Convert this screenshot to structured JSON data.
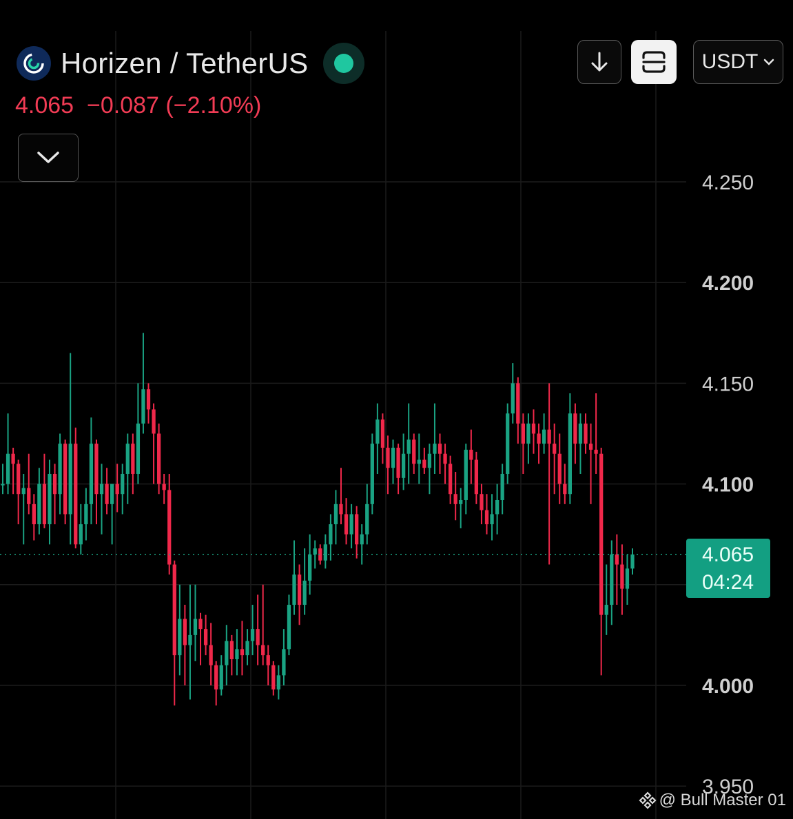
{
  "header": {
    "pair": "Horizen / TetherUS",
    "logo_icon": "horizen-logo-icon",
    "live_color": "#1fc7a0"
  },
  "price": {
    "last": "4.065",
    "change": "−0.087",
    "change_pct": "(−2.10%)",
    "color": "#f23c55"
  },
  "toolbar": {
    "quote_currency": "USDT",
    "download_icon": "arrow-down-icon",
    "fullscreen_icon": "frame-icon",
    "dropdown_icon": "chevron-down-icon",
    "collapse_icon": "chevron-down-icon"
  },
  "price_tag": {
    "value": "4.065",
    "countdown": "04:24"
  },
  "watermark": "@ Bull Master 01",
  "chart_data": {
    "type": "candlestick",
    "y_ticks": [
      "4.250",
      "4.200",
      "4.150",
      "4.100",
      "4.000",
      "3.950"
    ],
    "y_tick_values": [
      4.25,
      4.2,
      4.15,
      4.1,
      4.0,
      3.95
    ],
    "ylim": [
      3.945,
      4.32
    ],
    "grid": true,
    "up_color": "#1aa383",
    "down_color": "#f0284a",
    "current_price": 4.065,
    "candles": [
      [
        4.1,
        4.11,
        4.095,
        4.1
      ],
      [
        4.1,
        4.135,
        4.095,
        4.115
      ],
      [
        4.115,
        4.118,
        4.095,
        4.11
      ],
      [
        4.11,
        4.112,
        4.08,
        4.095
      ],
      [
        4.095,
        4.105,
        4.07,
        4.098
      ],
      [
        4.098,
        4.115,
        4.085,
        4.09
      ],
      [
        4.09,
        4.095,
        4.072,
        4.08
      ],
      [
        4.08,
        4.108,
        4.075,
        4.1
      ],
      [
        4.1,
        4.115,
        4.078,
        4.08
      ],
      [
        4.08,
        4.112,
        4.07,
        4.105
      ],
      [
        4.105,
        4.11,
        4.08,
        4.095
      ],
      [
        4.095,
        4.125,
        4.085,
        4.12
      ],
      [
        4.12,
        4.122,
        4.08,
        4.085
      ],
      [
        4.085,
        4.165,
        4.07,
        4.12
      ],
      [
        4.12,
        4.128,
        4.068,
        4.07
      ],
      [
        4.07,
        4.09,
        4.065,
        4.08
      ],
      [
        4.08,
        4.098,
        4.072,
        4.09
      ],
      [
        4.09,
        4.133,
        4.08,
        4.12
      ],
      [
        4.12,
        4.122,
        4.08,
        4.095
      ],
      [
        4.095,
        4.11,
        4.075,
        4.1
      ],
      [
        4.1,
        4.108,
        4.085,
        4.09
      ],
      [
        4.09,
        4.098,
        4.07,
        4.1
      ],
      [
        4.1,
        4.11,
        4.086,
        4.095
      ],
      [
        4.095,
        4.11,
        4.085,
        4.105
      ],
      [
        4.105,
        4.125,
        4.09,
        4.12
      ],
      [
        4.12,
        4.125,
        4.095,
        4.105
      ],
      [
        4.105,
        4.15,
        4.1,
        4.13
      ],
      [
        4.13,
        4.175,
        4.125,
        4.147
      ],
      [
        4.147,
        4.15,
        4.13,
        4.137
      ],
      [
        4.137,
        4.14,
        4.1,
        4.125
      ],
      [
        4.125,
        4.13,
        4.095,
        4.1
      ],
      [
        4.1,
        4.105,
        4.09,
        4.097
      ],
      [
        4.097,
        4.105,
        4.055,
        4.06
      ],
      [
        4.06,
        4.062,
        3.99,
        4.015
      ],
      [
        4.015,
        4.05,
        4.005,
        4.033
      ],
      [
        4.033,
        4.04,
        4.0,
        4.02
      ],
      [
        4.02,
        4.05,
        3.993,
        4.025
      ],
      [
        4.025,
        4.05,
        4.012,
        4.033
      ],
      [
        4.033,
        4.036,
        4.01,
        4.028
      ],
      [
        4.028,
        4.035,
        4.015,
        4.02
      ],
      [
        4.02,
        4.031,
        4.0,
        4.01
      ],
      [
        4.01,
        4.012,
        3.99,
        3.998
      ],
      [
        3.998,
        4.015,
        3.995,
        4.01
      ],
      [
        4.01,
        4.03,
        4.0,
        4.022
      ],
      [
        4.022,
        4.025,
        4.005,
        4.013
      ],
      [
        4.013,
        4.028,
        4.005,
        4.018
      ],
      [
        4.018,
        4.032,
        4.005,
        4.015
      ],
      [
        4.015,
        4.028,
        4.01,
        4.022
      ],
      [
        4.022,
        4.04,
        4.015,
        4.028
      ],
      [
        4.028,
        4.045,
        4.01,
        4.02
      ],
      [
        4.02,
        4.05,
        4.01,
        4.015
      ],
      [
        4.015,
        4.02,
        4.0,
        4.01
      ],
      [
        4.01,
        4.012,
        3.995,
        3.998
      ],
      [
        3.998,
        4.01,
        3.993,
        4.005
      ],
      [
        4.005,
        4.028,
        4.0,
        4.018
      ],
      [
        4.018,
        4.045,
        4.015,
        4.04
      ],
      [
        4.04,
        4.072,
        4.035,
        4.055
      ],
      [
        4.055,
        4.06,
        4.03,
        4.04
      ],
      [
        4.04,
        4.068,
        4.035,
        4.052
      ],
      [
        4.052,
        4.075,
        4.045,
        4.065
      ],
      [
        4.065,
        4.072,
        4.058,
        4.068
      ],
      [
        4.068,
        4.07,
        4.06,
        4.062
      ],
      [
        4.062,
        4.075,
        4.058,
        4.07
      ],
      [
        4.07,
        4.085,
        4.062,
        4.08
      ],
      [
        4.08,
        4.097,
        4.07,
        4.09
      ],
      [
        4.09,
        4.108,
        4.08,
        4.085
      ],
      [
        4.085,
        4.093,
        4.07,
        4.075
      ],
      [
        4.075,
        4.09,
        4.068,
        4.085
      ],
      [
        4.085,
        4.089,
        4.063,
        4.07
      ],
      [
        4.07,
        4.08,
        4.06,
        4.075
      ],
      [
        4.075,
        4.1,
        4.07,
        4.09
      ],
      [
        4.09,
        4.125,
        4.085,
        4.12
      ],
      [
        4.12,
        4.14,
        4.105,
        4.132
      ],
      [
        4.132,
        4.135,
        4.11,
        4.118
      ],
      [
        4.118,
        4.124,
        4.095,
        4.108
      ],
      [
        4.108,
        4.122,
        4.1,
        4.118
      ],
      [
        4.118,
        4.12,
        4.095,
        4.103
      ],
      [
        4.103,
        4.125,
        4.097,
        4.115
      ],
      [
        4.115,
        4.14,
        4.1,
        4.122
      ],
      [
        4.122,
        4.125,
        4.105,
        4.11
      ],
      [
        4.11,
        4.125,
        4.1,
        4.112
      ],
      [
        4.112,
        4.118,
        4.105,
        4.108
      ],
      [
        4.108,
        4.12,
        4.095,
        4.115
      ],
      [
        4.115,
        4.14,
        4.105,
        4.12
      ],
      [
        4.12,
        4.125,
        4.105,
        4.115
      ],
      [
        4.115,
        4.12,
        4.1,
        4.11
      ],
      [
        4.11,
        4.114,
        4.09,
        4.095
      ],
      [
        4.095,
        4.106,
        4.082,
        4.09
      ],
      [
        4.09,
        4.098,
        4.078,
        4.092
      ],
      [
        4.092,
        4.12,
        4.085,
        4.117
      ],
      [
        4.117,
        4.127,
        4.1,
        4.112
      ],
      [
        4.112,
        4.116,
        4.09,
        4.095
      ],
      [
        4.095,
        4.1,
        4.08,
        4.087
      ],
      [
        4.087,
        4.095,
        4.075,
        4.08
      ],
      [
        4.08,
        4.095,
        4.072,
        4.085
      ],
      [
        4.085,
        4.1,
        4.075,
        4.092
      ],
      [
        4.092,
        4.11,
        4.085,
        4.105
      ],
      [
        4.105,
        4.14,
        4.1,
        4.135
      ],
      [
        4.135,
        4.16,
        4.13,
        4.15
      ],
      [
        4.15,
        4.153,
        4.12,
        4.13
      ],
      [
        4.13,
        4.135,
        4.105,
        4.12
      ],
      [
        4.12,
        4.135,
        4.11,
        4.13
      ],
      [
        4.13,
        4.137,
        4.115,
        4.125
      ],
      [
        4.125,
        4.13,
        4.11,
        4.12
      ],
      [
        4.12,
        4.135,
        4.115,
        4.127
      ],
      [
        4.127,
        4.15,
        4.06,
        4.12
      ],
      [
        4.12,
        4.13,
        4.095,
        4.115
      ],
      [
        4.115,
        4.125,
        4.09,
        4.1
      ],
      [
        4.1,
        4.11,
        4.09,
        4.095
      ],
      [
        4.095,
        4.145,
        4.09,
        4.135
      ],
      [
        4.135,
        4.14,
        4.11,
        4.12
      ],
      [
        4.12,
        4.135,
        4.105,
        4.13
      ],
      [
        4.13,
        4.135,
        4.115,
        4.12
      ],
      [
        4.12,
        4.13,
        4.09,
        4.117
      ],
      [
        4.117,
        4.145,
        4.105,
        4.115
      ],
      [
        4.115,
        4.118,
        4.005,
        4.035
      ],
      [
        4.035,
        4.06,
        4.025,
        4.04
      ],
      [
        4.04,
        4.072,
        4.03,
        4.065
      ],
      [
        4.065,
        4.075,
        4.04,
        4.06
      ],
      [
        4.06,
        4.07,
        4.035,
        4.048
      ],
      [
        4.048,
        4.065,
        4.04,
        4.058
      ],
      [
        4.058,
        4.068,
        4.055,
        4.065
      ]
    ]
  }
}
